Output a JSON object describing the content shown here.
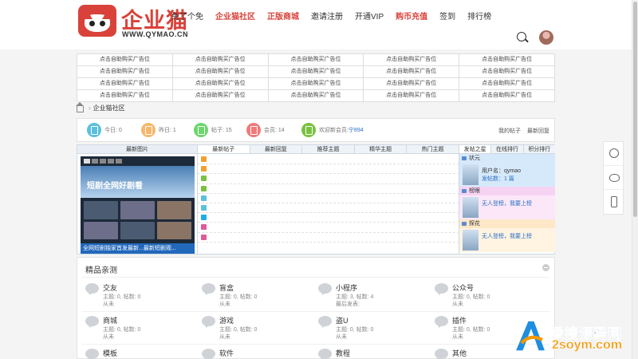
{
  "brand": {
    "name": "企业猫",
    "url": "WWW.QYMAO.CN"
  },
  "nav": [
    {
      "label": "免了个免",
      "highlight": false
    },
    {
      "label": "企业猫社区",
      "highlight": true
    },
    {
      "label": "正版商城",
      "highlight": true
    },
    {
      "label": "邀请注册",
      "highlight": false
    },
    {
      "label": "开通VIP",
      "highlight": false
    },
    {
      "label": "购币充值",
      "highlight": true
    },
    {
      "label": "签到",
      "highlight": false
    },
    {
      "label": "排行榜",
      "highlight": false
    }
  ],
  "ads": {
    "cell_text": "点击自助购买广告位",
    "rows": 4,
    "cols": 5
  },
  "breadcrumb": {
    "current": "企业猫社区"
  },
  "stats": {
    "items": [
      {
        "label": "今日: 0",
        "color": "#5bc0de"
      },
      {
        "label": "昨日: 1",
        "color": "#f5b86a"
      },
      {
        "label": "帖子: 15",
        "color": "#6cd56c"
      },
      {
        "label": "会员: 14",
        "color": "#f07a7a"
      },
      {
        "label": "欢迎新会员:",
        "color": "#7ac142"
      }
    ],
    "new_member": "宁894",
    "links": [
      "我的帖子",
      "最新回复"
    ]
  },
  "panel": {
    "left_tab": "最新图片",
    "mid_tabs": [
      "最新帖子",
      "最新回复",
      "推荐主题",
      "精华主题",
      "热门主题"
    ],
    "right_tabs": [
      "发帖之星",
      "在线排行",
      "积分排行"
    ],
    "slide_banner": "短剧全网好剧看",
    "slide_caption": "全网短剧独家首发最新...最新短剧观...",
    "row_colors": [
      "#f0a030",
      "#f0a030",
      "#7ac142",
      "#7ac142",
      "#5bc0de",
      "#5bc0de",
      "#1ab0e0",
      "#e05a9a",
      "#e05a9a"
    ]
  },
  "members": [
    {
      "title": "状元",
      "head_color": "#d6e9fb",
      "body_color": "#d6e9fb",
      "line1": "用户名：qymao",
      "line2": "发帖数：1 篇"
    },
    {
      "title": "榜眼",
      "head_color": "#f6d3f2",
      "body_color": "#fbe7f8",
      "line1": "无人登榜，我要上榜",
      "line2": ""
    },
    {
      "title": "探花",
      "head_color": "#fde7c7",
      "body_color": "#fff3e2",
      "line1": "无人登榜，我要上榜",
      "line2": ""
    }
  ],
  "featured": {
    "title": "精品亲测",
    "forums": [
      {
        "name": "交友",
        "stats": "主题: 0, 帖数: 0",
        "last": "从未"
      },
      {
        "name": "盲盒",
        "stats": "主题: 0, 帖数: 0",
        "last": "从未"
      },
      {
        "name": "小程序",
        "stats": "主题: 3, 帖数: 4",
        "last": "最后发表:"
      },
      {
        "name": "公众号",
        "stats": "主题: 0, 帖数: 0",
        "last": "从未"
      },
      {
        "name": "商城",
        "stats": "主题: 0, 帖数: 0",
        "last": "从未"
      },
      {
        "name": "游戏",
        "stats": "主题: 0, 帖数: 0",
        "last": "从未"
      },
      {
        "name": "盗U",
        "stats": "主题: 0, 帖数: 0",
        "last": "从未"
      },
      {
        "name": "插件",
        "stats": "主题: 0, 帖数: 0",
        "last": "从未"
      },
      {
        "name": "模板",
        "stats": "",
        "last": ""
      },
      {
        "name": "软件",
        "stats": "",
        "last": ""
      },
      {
        "name": "教程",
        "stats": "",
        "last": ""
      },
      {
        "name": "其他",
        "stats": "",
        "last": ""
      }
    ]
  },
  "side_tools": [
    "headset-icon",
    "wechat-icon",
    "phone-icon"
  ],
  "watermark": {
    "cn": "爱搜源码网",
    "en": "2soym.com"
  }
}
